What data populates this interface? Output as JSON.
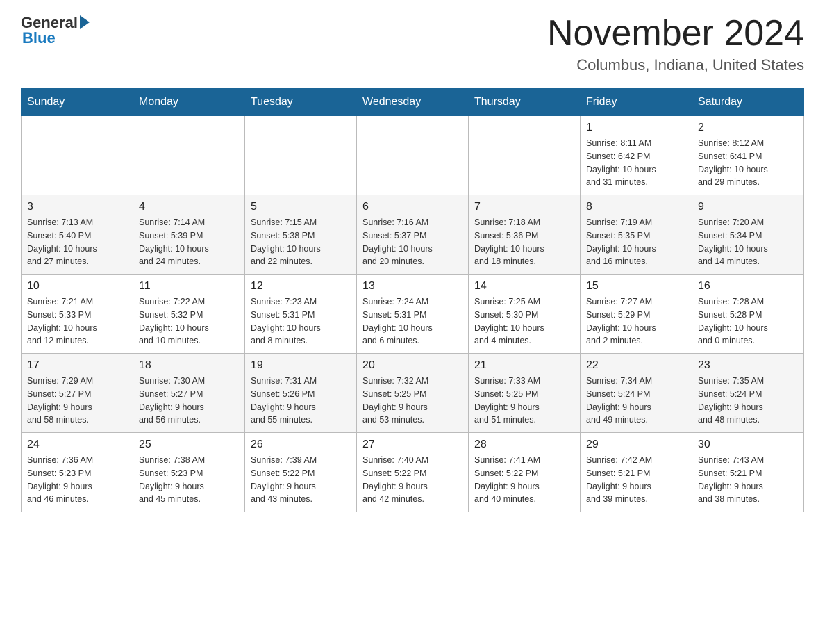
{
  "header": {
    "logo_text": "General",
    "logo_blue": "Blue",
    "month_title": "November 2024",
    "location": "Columbus, Indiana, United States"
  },
  "days_of_week": [
    "Sunday",
    "Monday",
    "Tuesday",
    "Wednesday",
    "Thursday",
    "Friday",
    "Saturday"
  ],
  "weeks": [
    [
      {
        "day": "",
        "info": ""
      },
      {
        "day": "",
        "info": ""
      },
      {
        "day": "",
        "info": ""
      },
      {
        "day": "",
        "info": ""
      },
      {
        "day": "",
        "info": ""
      },
      {
        "day": "1",
        "info": "Sunrise: 8:11 AM\nSunset: 6:42 PM\nDaylight: 10 hours\nand 31 minutes."
      },
      {
        "day": "2",
        "info": "Sunrise: 8:12 AM\nSunset: 6:41 PM\nDaylight: 10 hours\nand 29 minutes."
      }
    ],
    [
      {
        "day": "3",
        "info": "Sunrise: 7:13 AM\nSunset: 5:40 PM\nDaylight: 10 hours\nand 27 minutes."
      },
      {
        "day": "4",
        "info": "Sunrise: 7:14 AM\nSunset: 5:39 PM\nDaylight: 10 hours\nand 24 minutes."
      },
      {
        "day": "5",
        "info": "Sunrise: 7:15 AM\nSunset: 5:38 PM\nDaylight: 10 hours\nand 22 minutes."
      },
      {
        "day": "6",
        "info": "Sunrise: 7:16 AM\nSunset: 5:37 PM\nDaylight: 10 hours\nand 20 minutes."
      },
      {
        "day": "7",
        "info": "Sunrise: 7:18 AM\nSunset: 5:36 PM\nDaylight: 10 hours\nand 18 minutes."
      },
      {
        "day": "8",
        "info": "Sunrise: 7:19 AM\nSunset: 5:35 PM\nDaylight: 10 hours\nand 16 minutes."
      },
      {
        "day": "9",
        "info": "Sunrise: 7:20 AM\nSunset: 5:34 PM\nDaylight: 10 hours\nand 14 minutes."
      }
    ],
    [
      {
        "day": "10",
        "info": "Sunrise: 7:21 AM\nSunset: 5:33 PM\nDaylight: 10 hours\nand 12 minutes."
      },
      {
        "day": "11",
        "info": "Sunrise: 7:22 AM\nSunset: 5:32 PM\nDaylight: 10 hours\nand 10 minutes."
      },
      {
        "day": "12",
        "info": "Sunrise: 7:23 AM\nSunset: 5:31 PM\nDaylight: 10 hours\nand 8 minutes."
      },
      {
        "day": "13",
        "info": "Sunrise: 7:24 AM\nSunset: 5:31 PM\nDaylight: 10 hours\nand 6 minutes."
      },
      {
        "day": "14",
        "info": "Sunrise: 7:25 AM\nSunset: 5:30 PM\nDaylight: 10 hours\nand 4 minutes."
      },
      {
        "day": "15",
        "info": "Sunrise: 7:27 AM\nSunset: 5:29 PM\nDaylight: 10 hours\nand 2 minutes."
      },
      {
        "day": "16",
        "info": "Sunrise: 7:28 AM\nSunset: 5:28 PM\nDaylight: 10 hours\nand 0 minutes."
      }
    ],
    [
      {
        "day": "17",
        "info": "Sunrise: 7:29 AM\nSunset: 5:27 PM\nDaylight: 9 hours\nand 58 minutes."
      },
      {
        "day": "18",
        "info": "Sunrise: 7:30 AM\nSunset: 5:27 PM\nDaylight: 9 hours\nand 56 minutes."
      },
      {
        "day": "19",
        "info": "Sunrise: 7:31 AM\nSunset: 5:26 PM\nDaylight: 9 hours\nand 55 minutes."
      },
      {
        "day": "20",
        "info": "Sunrise: 7:32 AM\nSunset: 5:25 PM\nDaylight: 9 hours\nand 53 minutes."
      },
      {
        "day": "21",
        "info": "Sunrise: 7:33 AM\nSunset: 5:25 PM\nDaylight: 9 hours\nand 51 minutes."
      },
      {
        "day": "22",
        "info": "Sunrise: 7:34 AM\nSunset: 5:24 PM\nDaylight: 9 hours\nand 49 minutes."
      },
      {
        "day": "23",
        "info": "Sunrise: 7:35 AM\nSunset: 5:24 PM\nDaylight: 9 hours\nand 48 minutes."
      }
    ],
    [
      {
        "day": "24",
        "info": "Sunrise: 7:36 AM\nSunset: 5:23 PM\nDaylight: 9 hours\nand 46 minutes."
      },
      {
        "day": "25",
        "info": "Sunrise: 7:38 AM\nSunset: 5:23 PM\nDaylight: 9 hours\nand 45 minutes."
      },
      {
        "day": "26",
        "info": "Sunrise: 7:39 AM\nSunset: 5:22 PM\nDaylight: 9 hours\nand 43 minutes."
      },
      {
        "day": "27",
        "info": "Sunrise: 7:40 AM\nSunset: 5:22 PM\nDaylight: 9 hours\nand 42 minutes."
      },
      {
        "day": "28",
        "info": "Sunrise: 7:41 AM\nSunset: 5:22 PM\nDaylight: 9 hours\nand 40 minutes."
      },
      {
        "day": "29",
        "info": "Sunrise: 7:42 AM\nSunset: 5:21 PM\nDaylight: 9 hours\nand 39 minutes."
      },
      {
        "day": "30",
        "info": "Sunrise: 7:43 AM\nSunset: 5:21 PM\nDaylight: 9 hours\nand 38 minutes."
      }
    ]
  ]
}
